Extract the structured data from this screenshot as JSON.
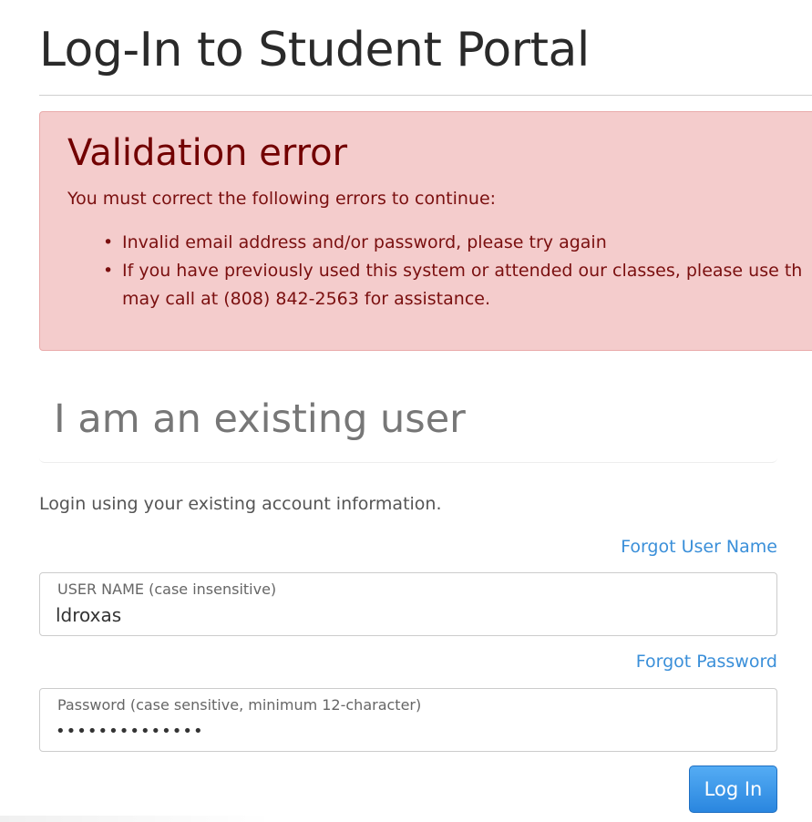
{
  "page": {
    "title": "Log-In to Student Portal"
  },
  "alert": {
    "heading": "Validation error",
    "intro": "You must correct the following errors to continue:",
    "errors": [
      {
        "lines": [
          "Invalid email address and/or password, please try again"
        ]
      },
      {
        "lines": [
          "If you have previously used this system or attended our classes, please use th",
          "may call at (808) 842-2563 for assistance."
        ]
      }
    ],
    "bullet": "•",
    "colors": {
      "background": "#f4cccc",
      "text": "#7a0f0f"
    }
  },
  "existing_user": {
    "heading": "I am an existing user",
    "intro": "Login using your existing account information.",
    "forgot_user_name": "Forgot User Name",
    "forgot_password": "Forgot Password",
    "username": {
      "label": "USER NAME (case insensitive)",
      "value": "ldroxas"
    },
    "password": {
      "label": "Password (case sensitive, minimum 12-character)",
      "value": "••••••••••••••"
    },
    "login_button": "Log In"
  },
  "colors": {
    "link": "#3a8fd9",
    "button": "#2a86df"
  }
}
